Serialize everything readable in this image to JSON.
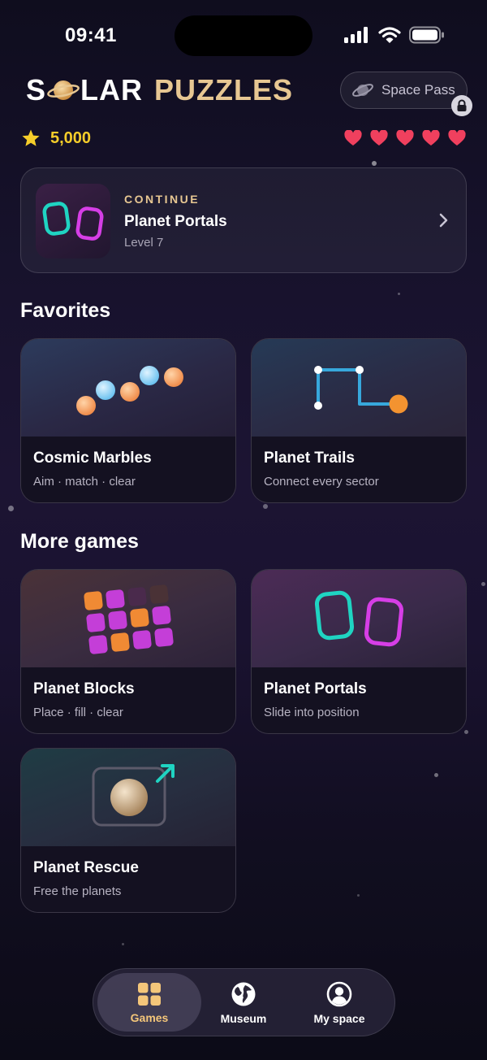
{
  "status": {
    "time": "09:41"
  },
  "header": {
    "logo_part1": "S",
    "logo_part2": "LAR",
    "logo_part3": "PUZZLES",
    "pass_label": "Space Pass"
  },
  "user": {
    "points": "5,000",
    "lives": 5
  },
  "continue": {
    "eyebrow": "CONTINUE",
    "title": "Planet Portals",
    "level": "Level 7"
  },
  "favorites": {
    "heading": "Favorites",
    "games": [
      {
        "title": "Cosmic Marbles",
        "subtitle": "Aim · match · clear"
      },
      {
        "title": "Planet Trails",
        "subtitle": "Connect every sector"
      }
    ]
  },
  "more": {
    "heading": "More games",
    "games": [
      {
        "title": "Planet Blocks",
        "subtitle": "Place · fill · clear"
      },
      {
        "title": "Planet Portals",
        "subtitle": "Slide into position"
      },
      {
        "title": "Planet Rescue",
        "subtitle": "Free the planets"
      }
    ]
  },
  "nav": {
    "items": [
      {
        "label": "Games",
        "icon": "grid-icon",
        "active": true
      },
      {
        "label": "Museum",
        "icon": "globe-icon",
        "active": false
      },
      {
        "label": "My space",
        "icon": "user-icon",
        "active": false
      }
    ]
  },
  "colors": {
    "gold": "#e7c792",
    "star": "#f5cd2a",
    "heart": "#f0405e",
    "teal": "#1fd4c2",
    "magenta": "#d63ee6",
    "orange": "#f0a055",
    "trail": "#37a8dc"
  }
}
